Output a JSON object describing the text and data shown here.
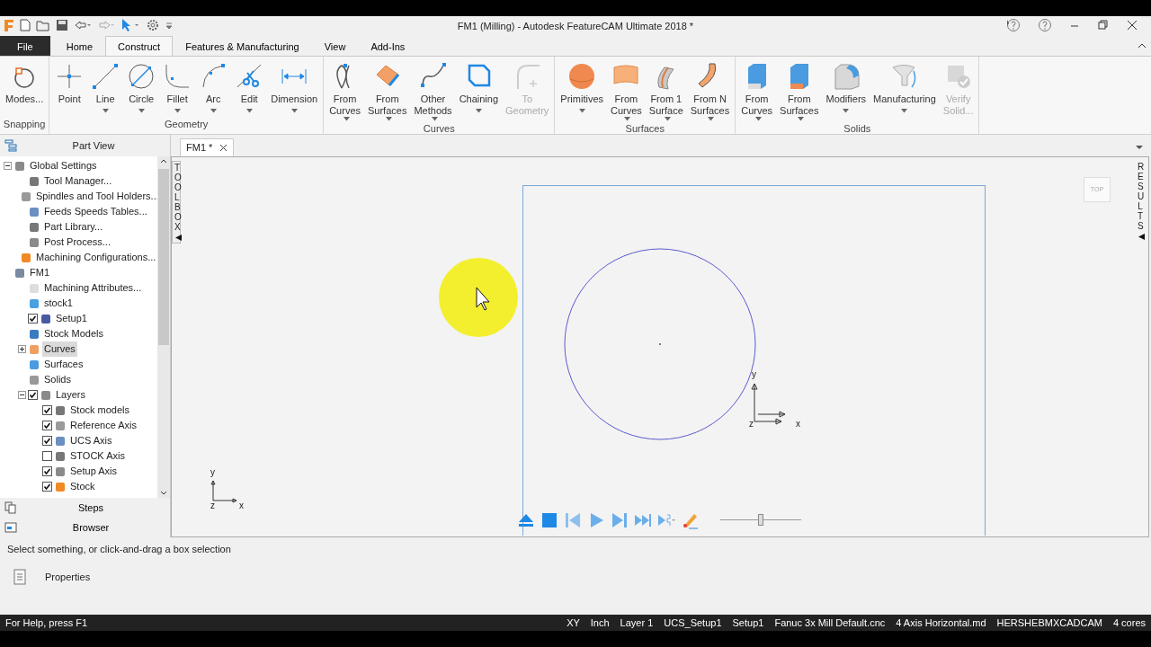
{
  "window": {
    "title": "FM1 (Milling) - Autodesk FeatureCAM Ultimate 2018 *"
  },
  "menu_tabs": [
    {
      "label": "File",
      "kind": "file",
      "selected": false
    },
    {
      "label": "Home",
      "kind": "tab",
      "selected": false
    },
    {
      "label": "Construct",
      "kind": "tab",
      "selected": true
    },
    {
      "label": "Features & Manufacturing",
      "kind": "tab",
      "selected": false
    },
    {
      "label": "View",
      "kind": "tab",
      "selected": false
    },
    {
      "label": "Add-Ins",
      "kind": "tab",
      "selected": false
    }
  ],
  "ribbon": [
    {
      "label": "Snapping",
      "buttons": [
        {
          "label": "Modes...",
          "dropdown": false,
          "disabled": false
        }
      ]
    },
    {
      "label": "Geometry",
      "buttons": [
        {
          "label": "Point",
          "dropdown": false,
          "disabled": false
        },
        {
          "label": "Line",
          "dropdown": true,
          "disabled": false
        },
        {
          "label": "Circle",
          "dropdown": true,
          "disabled": false
        },
        {
          "label": "Fillet",
          "dropdown": true,
          "disabled": false
        },
        {
          "label": "Arc",
          "dropdown": true,
          "disabled": false
        },
        {
          "label": "Edit",
          "dropdown": true,
          "disabled": false
        },
        {
          "label": "Dimension",
          "dropdown": true,
          "disabled": false
        }
      ]
    },
    {
      "label": "Curves",
      "buttons": [
        {
          "label": "From\nCurves",
          "dropdown": true,
          "disabled": false
        },
        {
          "label": "From\nSurfaces",
          "dropdown": true,
          "disabled": false
        },
        {
          "label": "Other\nMethods",
          "dropdown": true,
          "disabled": false
        },
        {
          "label": "Chaining",
          "dropdown": true,
          "disabled": false
        },
        {
          "label": "To\nGeometry",
          "dropdown": false,
          "disabled": true
        }
      ]
    },
    {
      "label": "Surfaces",
      "buttons": [
        {
          "label": "Primitives",
          "dropdown": true,
          "disabled": false
        },
        {
          "label": "From\nCurves",
          "dropdown": true,
          "disabled": false
        },
        {
          "label": "From 1\nSurface",
          "dropdown": true,
          "disabled": false
        },
        {
          "label": "From N\nSurfaces",
          "dropdown": true,
          "disabled": false
        }
      ]
    },
    {
      "label": "Solids",
      "buttons": [
        {
          "label": "From\nCurves",
          "dropdown": true,
          "disabled": false
        },
        {
          "label": "From\nSurfaces",
          "dropdown": true,
          "disabled": false
        },
        {
          "label": "Modifiers",
          "dropdown": true,
          "disabled": false
        },
        {
          "label": "Manufacturing",
          "dropdown": true,
          "disabled": false
        },
        {
          "label": "Verify\nSolid...",
          "dropdown": false,
          "disabled": true
        }
      ]
    }
  ],
  "document_tabs": [
    {
      "label": "FM1 *",
      "selected": true
    }
  ],
  "part_view": {
    "title": "Part View",
    "tree": [
      {
        "label": "Global Settings",
        "expanded": true,
        "selected": false,
        "children": [
          {
            "label": "Tool Manager...",
            "selected": false
          },
          {
            "label": "Spindles and Tool Holders...",
            "selected": false
          },
          {
            "label": "Feeds  Speeds Tables...",
            "selected": false
          },
          {
            "label": "Part Library...",
            "selected": false
          },
          {
            "label": "Post Process...",
            "selected": false
          },
          {
            "label": "Machining Configurations...",
            "selected": false
          }
        ]
      },
      {
        "label": "FM1",
        "selected": false,
        "children": [
          {
            "label": "Machining Attributes...",
            "selected": false
          },
          {
            "label": "stock1",
            "selected": false
          },
          {
            "label": "Setup1",
            "checked": true,
            "selected": false
          },
          {
            "label": "Stock Models",
            "selected": false
          },
          {
            "label": "Curves",
            "expanded": false,
            "selected": true
          },
          {
            "label": "Surfaces",
            "selected": false
          },
          {
            "label": "Solids",
            "selected": false
          },
          {
            "label": "Layers",
            "expanded": true,
            "checked": true,
            "selected": false,
            "children": [
              {
                "label": "Stock models",
                "checked": true,
                "selected": false
              },
              {
                "label": "Reference Axis",
                "checked": true,
                "selected": false
              },
              {
                "label": "UCS Axis",
                "checked": true,
                "selected": false
              },
              {
                "label": "STOCK Axis",
                "checked": false,
                "selected": false
              },
              {
                "label": "Setup Axis",
                "checked": true,
                "selected": false
              },
              {
                "label": "Stock",
                "checked": true,
                "selected": false
              }
            ]
          }
        ]
      }
    ],
    "bottom_tabs": [
      "Steps",
      "Browser"
    ]
  },
  "canvas": {
    "toolbox": "TOOLBOX",
    "results": "RESULTS",
    "view_cube": "TOP",
    "part_axis": [
      "y",
      "x",
      "z"
    ],
    "corner_axis": [
      "y",
      "z",
      "x"
    ],
    "playback": {
      "level": 0.5
    }
  },
  "status_message": "Select something, or click-and-drag a box selection",
  "properties": "Properties",
  "status_bar": {
    "help": "For Help, press F1",
    "items": [
      "XY",
      "Inch",
      "Layer 1",
      "UCS_Setup1",
      "Setup1",
      "Fanuc 3x Mill Default.cnc",
      "4 Axis Horizontal.md",
      "HERSHEBMXCADCAM",
      "4 cores"
    ]
  }
}
